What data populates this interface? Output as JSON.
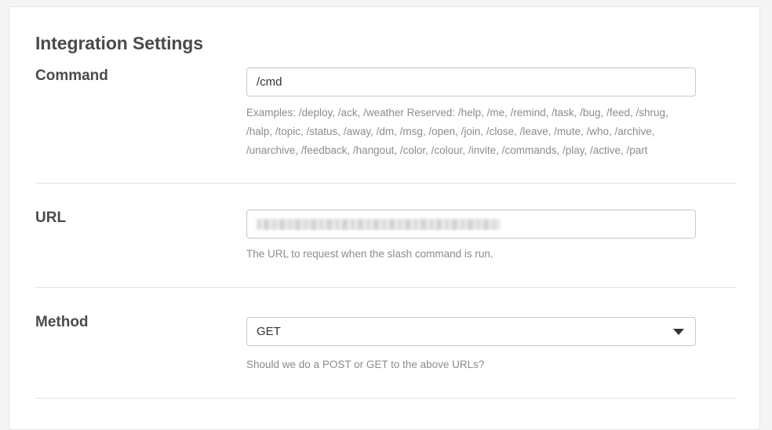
{
  "page": {
    "title": "Integration Settings"
  },
  "command": {
    "label": "Command",
    "value": "/cmd",
    "help": "Examples: /deploy, /ack, /weather Reserved: /help, /me, /remind, /task, /bug, /feed, /shrug, /halp, /topic, /status, /away, /dm, /msg, /open, /join, /close, /leave, /mute, /who, /archive, /unarchive, /feedback, /hangout, /color, /colour, /invite, /commands, /play, /active, /part"
  },
  "url": {
    "label": "URL",
    "help": "The URL to request when the slash command is run."
  },
  "method": {
    "label": "Method",
    "selected": "GET",
    "help": "Should we do a POST or GET to the above URLs?"
  }
}
